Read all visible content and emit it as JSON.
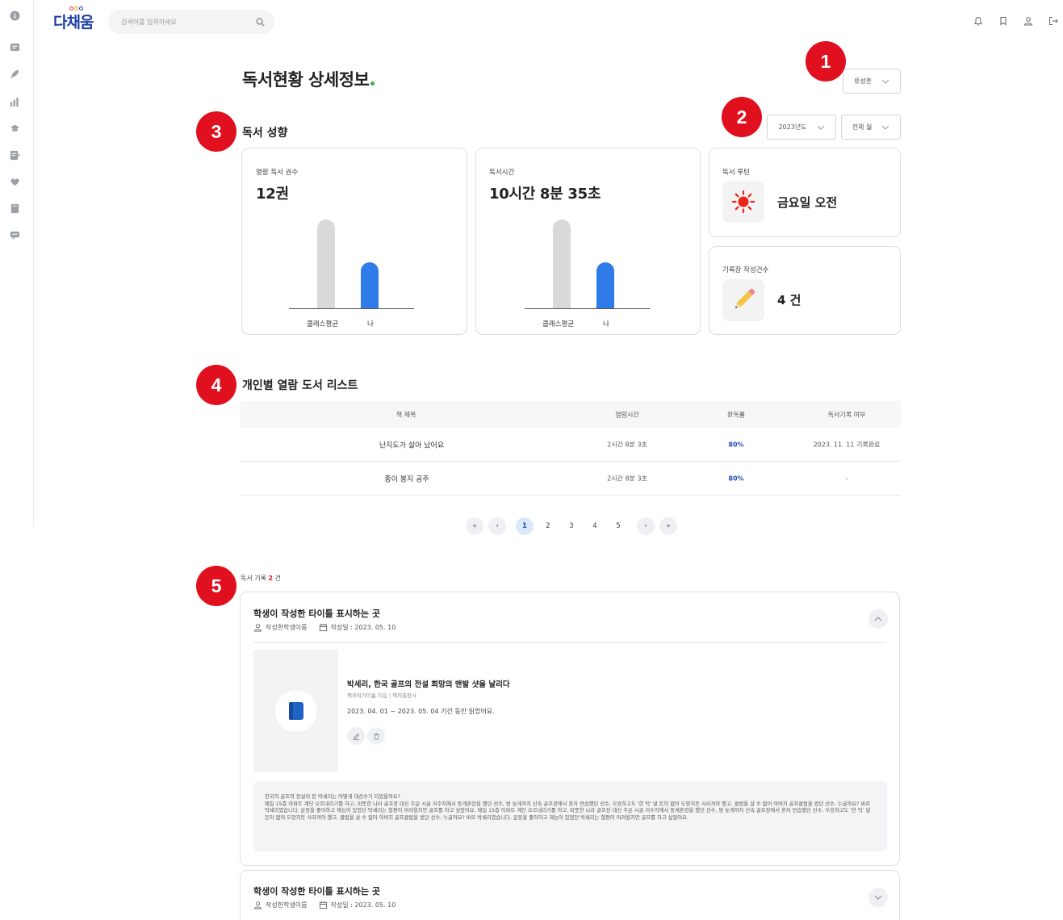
{
  "header": {
    "logo_text": "다채움",
    "search_placeholder": "검색어를 입력하세요"
  },
  "rail_icons": [
    "info-icon",
    "message-icon",
    "rocket-icon",
    "chart-icon",
    "graduation-cap-icon",
    "edit-note-icon",
    "heart-icon",
    "book-icon",
    "comment-icon"
  ],
  "top_icons": [
    "bell-icon",
    "bookmark-icon",
    "user-icon",
    "logout-icon"
  ],
  "page": {
    "title": "독서현황 상세정보"
  },
  "filters": {
    "student": "류성훈",
    "year": "2023년도",
    "month": "전체 월"
  },
  "badges": [
    "1",
    "2",
    "3",
    "4",
    "5"
  ],
  "tendency": {
    "title": "독서 성향",
    "books_read": {
      "label": "열람 독서 권수",
      "value": "12권",
      "class_avg_label": "클래스평균",
      "me_label": "나",
      "class_avg_ratio": 1.0,
      "me_ratio": 0.52
    },
    "reading_time": {
      "label": "독서시간",
      "value": "10시간 8분 35초",
      "class_avg_label": "클래스평균",
      "me_label": "나",
      "class_avg_ratio": 1.0,
      "me_ratio": 0.52
    },
    "routine": {
      "label": "독서 루틴",
      "value": "금요일 오전",
      "icon": "sun-icon"
    },
    "records": {
      "label": "기록장 작성건수",
      "value": "4 건",
      "icon": "pencil-icon"
    }
  },
  "book_list": {
    "title": "개인별 열람 도서 리스트",
    "columns": [
      "책 제목",
      "열람시간",
      "완독률",
      "독서기록 여부"
    ],
    "rows": [
      {
        "title": "난지도가 살아 났어요",
        "time": "2시간 8분 3초",
        "rate": "80%",
        "record": "2023. 11. 11 기록완료"
      },
      {
        "title": "종이 봉지 공주",
        "time": "2시간 8분 3초",
        "rate": "80%",
        "record": "-"
      }
    ]
  },
  "pagination": {
    "pages": [
      "1",
      "2",
      "3",
      "4",
      "5"
    ],
    "current": "1"
  },
  "reading_records": {
    "count_prefix": "독서 기록",
    "count": "2",
    "count_suffix": "건",
    "items": [
      {
        "title": "학생이 작성한 타이틀 표시하는 곳",
        "author": "작성한학생이름",
        "date": "작성일 : 2023. 05. 10",
        "book_title": "박세리, 한국 골프의 전설 희망의 맨발 샷을 날리다",
        "book_sub": "책의작가이름 지음 | 책의출판사",
        "period": "2023. 04. 01 ~ 2023. 05. 04 기간 동안 읽었어요.",
        "review": "한국의 골프의 전설이 된 박세리는 어떻게 대선수가 되었을까요?\n매일 15층 아파트 계단 오르내리기를 하고, 따뜻한 나라 골프장 대신 주운 시골 저수지에서 동계훈련을 했던 선수, 밤 늦게까지 산속 골프장에서 혼자 연습했던 선수, 우승하고도 '한 턱' 낼 돈이 없어 도망치듯 사라져야 했고, 클럽을 살 수 없어 아버지 골프클럽을 썼던 선수, 누굴까요? 바로 박세리였습니다. 운동을 좋아하고 재능이 있었던 박세리는 형편이 어려웠지만 골프를 하고 싶었어요. 매일 15층 아파트 계단 오르내리기를 하고, 따뜻한 나라 골프장 대신 주운 시골 저수지에서 동계훈련을 했던 선수, 밤 늦게까지 산속 골프장에서 혼자 연습했던 선수, 우승하고도 '한 턱' 낼 돈이 없어 도망치듯 사라져야 했고, 클럽을 살 수 없어 아버지 골프클럽을 썼던 선수, 누굴까요? 바로 박세리였습니다. 운동을 좋아하고 재능이 있었던 박세리는 형편이 어려웠지만 골프를 하고 싶었어요."
      },
      {
        "title": "학생이 작성한 타이틀 표시하는 곳",
        "author": "작성한학생이름",
        "date": "작성일 : 2023. 05. 10"
      }
    ]
  },
  "colors": {
    "accent_blue": "#2f7be8",
    "badge_red": "#e0101f",
    "logo_blue": "#1d3fa3"
  }
}
